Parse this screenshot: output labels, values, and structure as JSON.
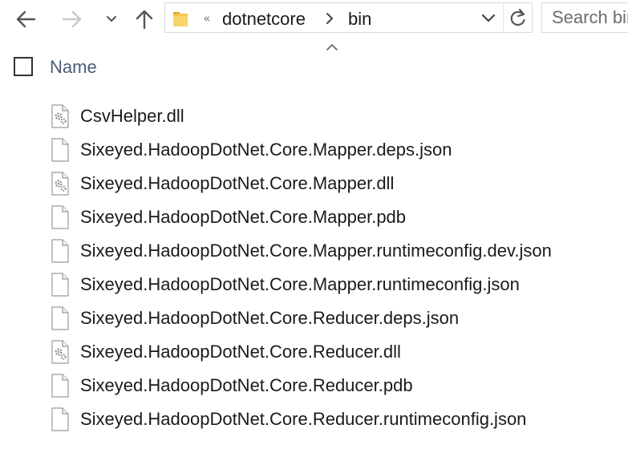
{
  "toolbar": {
    "back_icon": "arrow-left-icon",
    "forward_icon": "arrow-right-icon",
    "recent_icon": "chevron-down-icon",
    "up_icon": "arrow-up-icon"
  },
  "address_bar": {
    "folder_icon": "folder-icon",
    "overflow": "«",
    "breadcrumbs": [
      "dotnetcore",
      "bin"
    ],
    "dropdown_icon": "chevron-down-icon",
    "refresh_icon": "refresh-icon"
  },
  "search": {
    "placeholder": "Search bin"
  },
  "header": {
    "name_column": "Name",
    "sort_icon": "sort-ascending-icon"
  },
  "files": [
    {
      "name": "CsvHelper.dll",
      "icon": "dll-file-icon"
    },
    {
      "name": "Sixeyed.HadoopDotNet.Core.Mapper.deps.json",
      "icon": "generic-file-icon"
    },
    {
      "name": "Sixeyed.HadoopDotNet.Core.Mapper.dll",
      "icon": "dll-file-icon"
    },
    {
      "name": "Sixeyed.HadoopDotNet.Core.Mapper.pdb",
      "icon": "generic-file-icon"
    },
    {
      "name": "Sixeyed.HadoopDotNet.Core.Mapper.runtimeconfig.dev.json",
      "icon": "generic-file-icon"
    },
    {
      "name": "Sixeyed.HadoopDotNet.Core.Mapper.runtimeconfig.json",
      "icon": "generic-file-icon"
    },
    {
      "name": "Sixeyed.HadoopDotNet.Core.Reducer.deps.json",
      "icon": "generic-file-icon"
    },
    {
      "name": "Sixeyed.HadoopDotNet.Core.Reducer.dll",
      "icon": "dll-file-icon"
    },
    {
      "name": "Sixeyed.HadoopDotNet.Core.Reducer.pdb",
      "icon": "generic-file-icon"
    },
    {
      "name": "Sixeyed.HadoopDotNet.Core.Reducer.runtimeconfig.json",
      "icon": "generic-file-icon"
    }
  ],
  "colors": {
    "folder_yellow": "#f2c94c",
    "folder_dark": "#d9a520",
    "header_text": "#4b5d74",
    "nav_active": "#555555",
    "nav_disabled": "#c8c8c8"
  }
}
